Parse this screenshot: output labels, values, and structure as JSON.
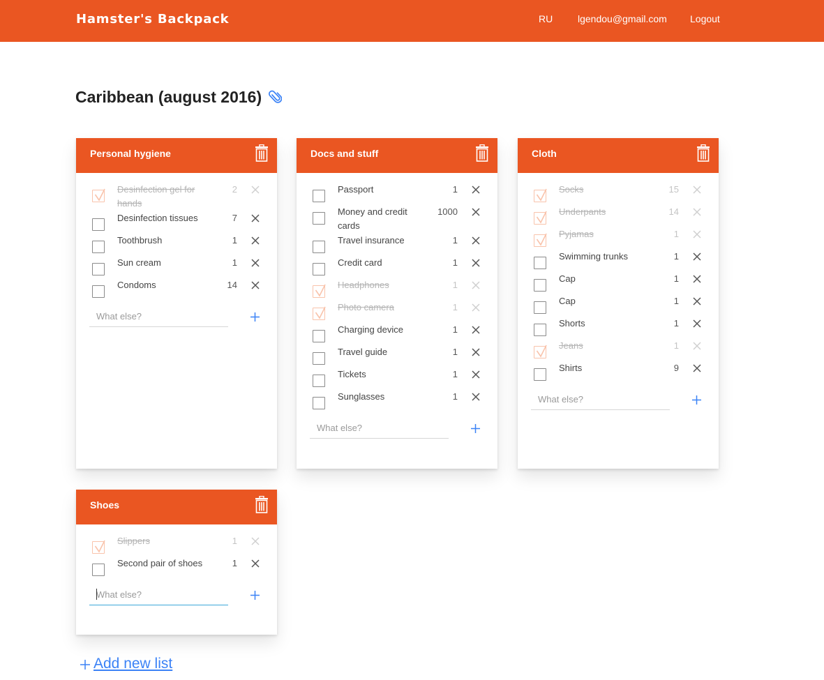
{
  "header": {
    "brand": "Hamster's Backpack",
    "lang": "RU",
    "email": "lgendou@gmail.com",
    "logout": "Logout",
    "accent_color": "#ea5622"
  },
  "trip": {
    "title": "Caribbean (august 2016)",
    "attach_icon": "paperclip-icon"
  },
  "lists": [
    {
      "title": "Personal hygiene",
      "add_placeholder": "What else?",
      "items": [
        {
          "name": "Desinfection gel for hands",
          "qty": "2",
          "done": true
        },
        {
          "name": "Desinfection tissues",
          "qty": "7",
          "done": false
        },
        {
          "name": "Toothbrush",
          "qty": "1",
          "done": false
        },
        {
          "name": "Sun cream",
          "qty": "1",
          "done": false
        },
        {
          "name": "Condoms",
          "qty": "14",
          "done": false
        }
      ]
    },
    {
      "title": "Docs and stuff",
      "add_placeholder": "What else?",
      "items": [
        {
          "name": "Passport",
          "qty": "1",
          "done": false
        },
        {
          "name": "Money and credit cards",
          "qty": "1000",
          "done": false
        },
        {
          "name": "Travel insurance",
          "qty": "1",
          "done": false
        },
        {
          "name": "Credit card",
          "qty": "1",
          "done": false
        },
        {
          "name": "Headphones",
          "qty": "1",
          "done": true
        },
        {
          "name": "Photo camera",
          "qty": "1",
          "done": true
        },
        {
          "name": "Charging device",
          "qty": "1",
          "done": false
        },
        {
          "name": "Travel guide",
          "qty": "1",
          "done": false
        },
        {
          "name": "Tickets",
          "qty": "1",
          "done": false
        },
        {
          "name": "Sunglasses",
          "qty": "1",
          "done": false
        }
      ]
    },
    {
      "title": "Cloth",
      "add_placeholder": "What else?",
      "items": [
        {
          "name": "Socks",
          "qty": "15",
          "done": true
        },
        {
          "name": "Underpants",
          "qty": "14",
          "done": true
        },
        {
          "name": "Pyjamas",
          "qty": "1",
          "done": true
        },
        {
          "name": "Swimming trunks",
          "qty": "1",
          "done": false
        },
        {
          "name": "Cap",
          "qty": "1",
          "done": false
        },
        {
          "name": "Cap",
          "qty": "1",
          "done": false
        },
        {
          "name": "Shorts",
          "qty": "1",
          "done": false
        },
        {
          "name": "Jeans",
          "qty": "1",
          "done": true
        },
        {
          "name": "Shirts",
          "qty": "9",
          "done": false
        }
      ]
    },
    {
      "title": "Shoes",
      "add_placeholder": "What else?",
      "items": [
        {
          "name": "Slippers",
          "qty": "1",
          "done": true
        },
        {
          "name": "Second pair of shoes",
          "qty": "1",
          "done": false
        }
      ]
    }
  ],
  "footer": {
    "add_list": "Add new list"
  }
}
